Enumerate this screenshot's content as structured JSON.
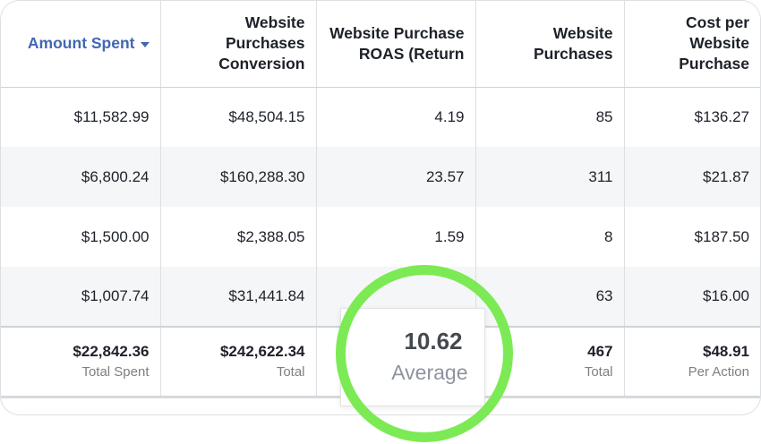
{
  "columns": [
    {
      "label": "Amount Spent",
      "sorted": true
    },
    {
      "label": "Website Purchases Conversion"
    },
    {
      "label": "Website Purchase ROAS (Return"
    },
    {
      "label": "Website Purchases"
    },
    {
      "label": "Cost per Website Purchase"
    }
  ],
  "rows": [
    [
      "$11,582.99",
      "$48,504.15",
      "4.19",
      "85",
      "$136.27"
    ],
    [
      "$6,800.24",
      "$160,288.30",
      "23.57",
      "311",
      "$21.87"
    ],
    [
      "$1,500.00",
      "$2,388.05",
      "1.59",
      "8",
      "$187.50"
    ],
    [
      "$1,007.74",
      "$31,441.84",
      "",
      "63",
      "$16.00"
    ]
  ],
  "totals": [
    {
      "value": "$22,842.36",
      "label": "Total Spent"
    },
    {
      "value": "$242,622.34",
      "label": "Total"
    },
    {
      "value": "10.62",
      "label": "Average"
    },
    {
      "value": "467",
      "label": "Total"
    },
    {
      "value": "$48.91",
      "label": "Per Action"
    }
  ],
  "highlight_color": "#7cea54",
  "accent_color": "#4267b2"
}
